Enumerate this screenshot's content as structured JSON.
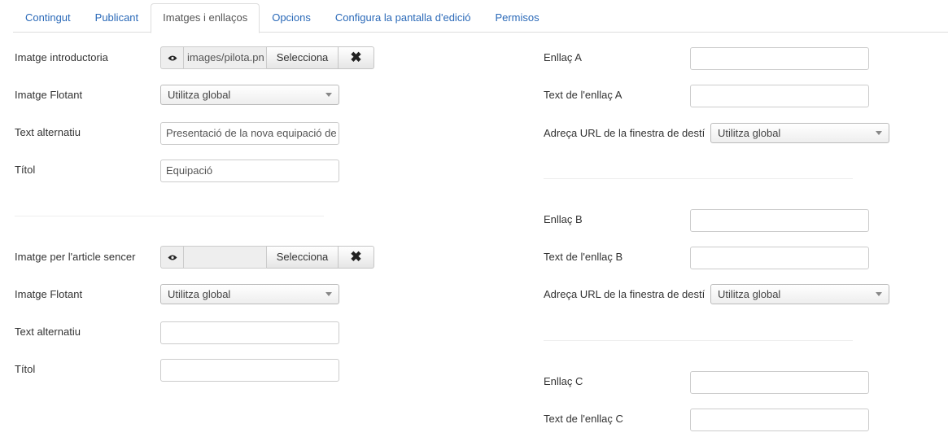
{
  "tabs": [
    {
      "label": "Contingut"
    },
    {
      "label": "Publicant"
    },
    {
      "label": "Imatges i enllaços"
    },
    {
      "label": "Opcions"
    },
    {
      "label": "Configura la pantalla d'edició"
    },
    {
      "label": "Permisos"
    }
  ],
  "active_tab": "Imatges i enllaços",
  "intro_image": {
    "label": "Imatge introductoria",
    "path_value": "images/pilota.pn",
    "select_label": "Selecciona",
    "clear_icon": "close-icon",
    "preview_icon": "eye-icon",
    "float_label": "Imatge Flotant",
    "float_value": "Utilitza global",
    "alt_label": "Text alternatiu",
    "alt_value": "Presentació de la nova equipació de",
    "title_label": "Títol",
    "title_value": "Equipació"
  },
  "full_image": {
    "label": "Imatge per l'article sencer",
    "path_value": "",
    "select_label": "Selecciona",
    "clear_icon": "close-icon",
    "preview_icon": "eye-icon",
    "float_label": "Imatge Flotant",
    "float_value": "Utilitza global",
    "alt_label": "Text alternatiu",
    "alt_value": "",
    "title_label": "Títol",
    "title_value": ""
  },
  "link_a": {
    "url_label": "Enllaç A",
    "url_value": "",
    "text_label": "Text de l'enllaç A",
    "text_value": "",
    "target_label": "Adreça URL de la finestra de destí",
    "target_value": "Utilitza global"
  },
  "link_b": {
    "url_label": "Enllaç B",
    "url_value": "",
    "text_label": "Text de l'enllaç B",
    "text_value": "",
    "target_label": "Adreça URL de la finestra de destí",
    "target_value": "Utilitza global"
  },
  "link_c": {
    "url_label": "Enllaç C",
    "url_value": "",
    "text_label": "Text de l'enllaç C",
    "text_value": ""
  },
  "colors": {
    "link": "#2a69b8",
    "border": "#dddddd",
    "text": "#333333"
  }
}
